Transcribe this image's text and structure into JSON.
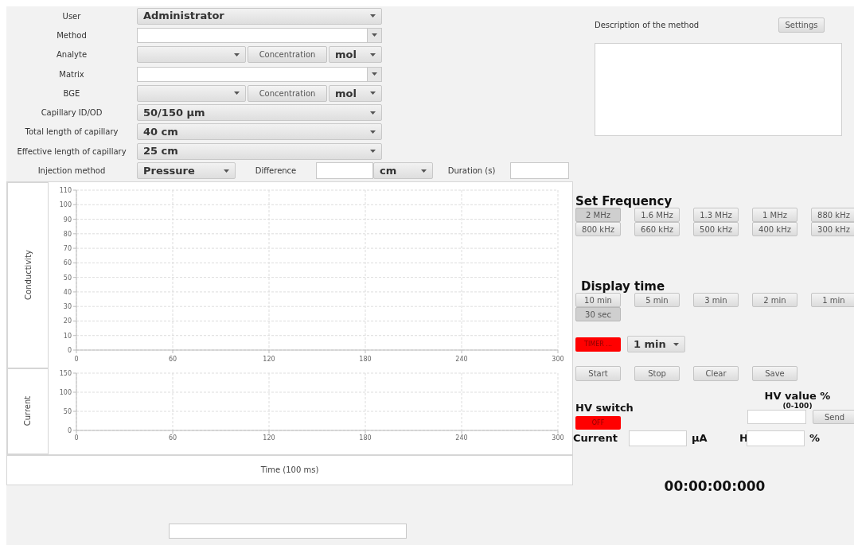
{
  "form": [
    {
      "label": "User",
      "kind": "select",
      "value": "Administrator"
    },
    {
      "label": "Method",
      "kind": "combo"
    },
    {
      "label": "Analyte",
      "kind": "concentration",
      "button": "Concentration",
      "unit": "mol"
    },
    {
      "label": "Matrix",
      "kind": "combo"
    },
    {
      "label": "BGE",
      "kind": "concentration",
      "button": "Concentration",
      "unit": "mol"
    },
    {
      "label": "Capillary ID/OD",
      "kind": "select",
      "value": "50/150 µm"
    },
    {
      "label": "Total length of capillary",
      "kind": "select",
      "value": "40 cm"
    },
    {
      "label": "Effective length of capillary",
      "kind": "select",
      "value": "25 cm"
    }
  ],
  "injection": {
    "label": "Injection method",
    "method": "Pressure",
    "difference_label": "Difference",
    "difference_unit": "cm",
    "duration_label": "Duration (s)"
  },
  "charts": [
    {
      "chart_data": {
        "type": "line",
        "grid": true,
        "ylabel": "Conductivity",
        "xlim": [
          0,
          300
        ],
        "ylim": [
          0,
          110
        ],
        "xticks": [
          0,
          60,
          120,
          180,
          240,
          300
        ],
        "yticks": [
          0,
          10,
          20,
          30,
          40,
          50,
          60,
          70,
          80,
          90,
          100,
          110
        ]
      }
    },
    {
      "chart_data": {
        "type": "line",
        "grid": true,
        "ylabel": "Current",
        "xlim": [
          0,
          300
        ],
        "ylim": [
          0,
          150
        ],
        "xticks": [
          0,
          60,
          120,
          180,
          240,
          300
        ],
        "yticks": [
          0,
          50,
          100,
          150
        ]
      }
    }
  ],
  "time_axis_label": "Time (100 ms)",
  "description": {
    "label": "Description of the method",
    "settings_button": "Settings"
  },
  "frequency": {
    "title": "Set Frequency",
    "options": [
      {
        "label": "2 MHz",
        "selected": true
      },
      {
        "label": "1.6 MHz",
        "selected": false
      },
      {
        "label": "1.3 MHz",
        "selected": false
      },
      {
        "label": "1 MHz",
        "selected": false
      },
      {
        "label": "880 kHz",
        "selected": false
      },
      {
        "label": "800 kHz",
        "selected": false
      },
      {
        "label": "660 kHz",
        "selected": false
      },
      {
        "label": "500 kHz",
        "selected": false
      },
      {
        "label": "400 kHz",
        "selected": false
      },
      {
        "label": "300 kHz",
        "selected": false
      }
    ]
  },
  "display_time": {
    "title": "Display time",
    "options": [
      {
        "label": "10 min",
        "selected": false
      },
      {
        "label": "5 min",
        "selected": false
      },
      {
        "label": "3 min",
        "selected": false
      },
      {
        "label": "2 min",
        "selected": false
      },
      {
        "label": "1 min",
        "selected": false
      },
      {
        "label": "30 sec",
        "selected": true
      }
    ]
  },
  "timer": {
    "label": "TIMER ...",
    "on": false,
    "duration": "1 min"
  },
  "actions": [
    "Start",
    "Stop",
    "Clear",
    "Save"
  ],
  "hv_switch": {
    "title": "HV switch",
    "label": "OFF",
    "on": false
  },
  "hv_value": {
    "title": "HV value %",
    "range": "(0-100)",
    "send_button": "Send"
  },
  "readouts": {
    "current_label": "Current",
    "current_unit": "µA",
    "h_label": "H",
    "h_unit": "%"
  },
  "clock": "00:00:00:000"
}
